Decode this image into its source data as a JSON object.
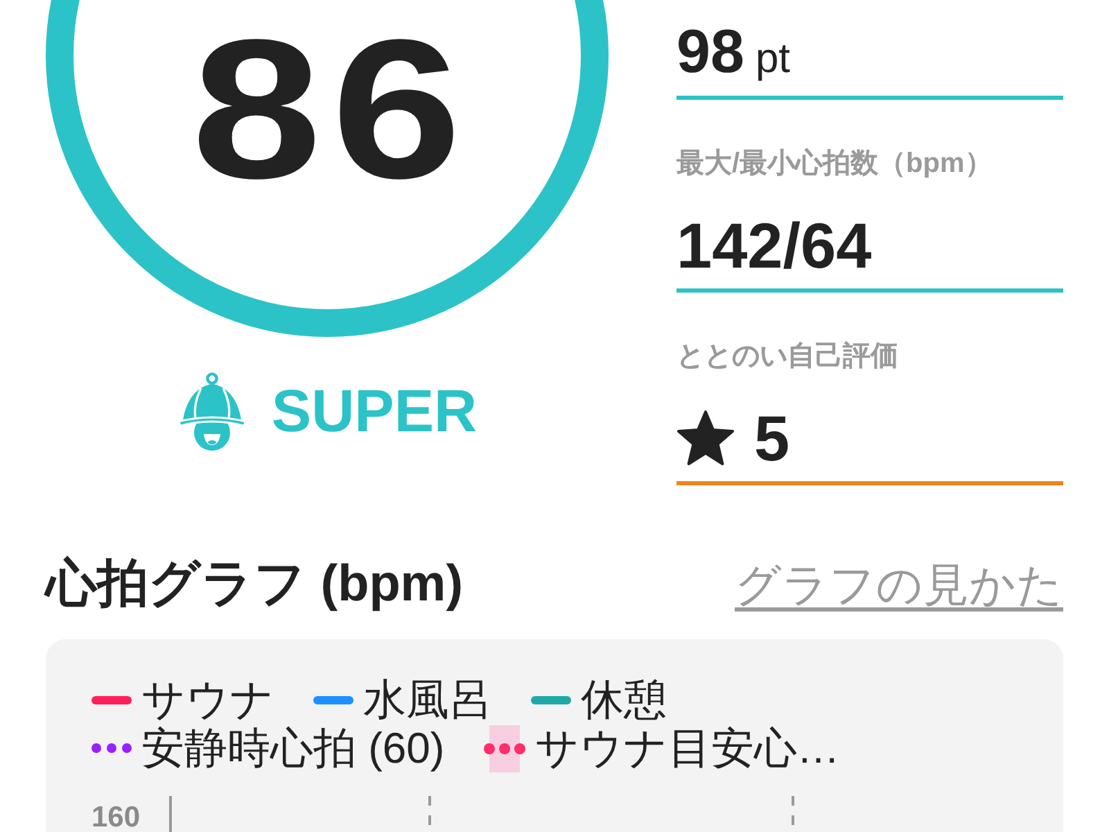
{
  "score": {
    "value": "86",
    "rank": "SUPER"
  },
  "stats": [
    {
      "kind": "value",
      "value": "98",
      "unit": "pt",
      "color": "#2bc3c8"
    },
    {
      "kind": "value",
      "label": "最大/最小心拍数（bpm）",
      "value": "142/64",
      "color": "#2bc3c8"
    },
    {
      "kind": "rating",
      "label": "ととのい自己評価",
      "value": "5",
      "color": "#f0841c"
    }
  ],
  "heart_rate_graph": {
    "title": "心拍グラフ (bpm)",
    "help_link": "グラフの見かた",
    "legend": [
      {
        "kind": "line",
        "label": "サウナ",
        "color": "#ff1f5a"
      },
      {
        "kind": "line",
        "label": "水風呂",
        "color": "#1e8fff"
      },
      {
        "kind": "line",
        "label": "休憩",
        "color": "#1fa9a6"
      },
      {
        "kind": "dotted",
        "label": "安静時心拍 (60)",
        "color": "#9a1fff"
      },
      {
        "kind": "band",
        "label": "サウナ目安心…",
        "color": "#ff2d6a"
      }
    ],
    "y_tick": "160"
  }
}
